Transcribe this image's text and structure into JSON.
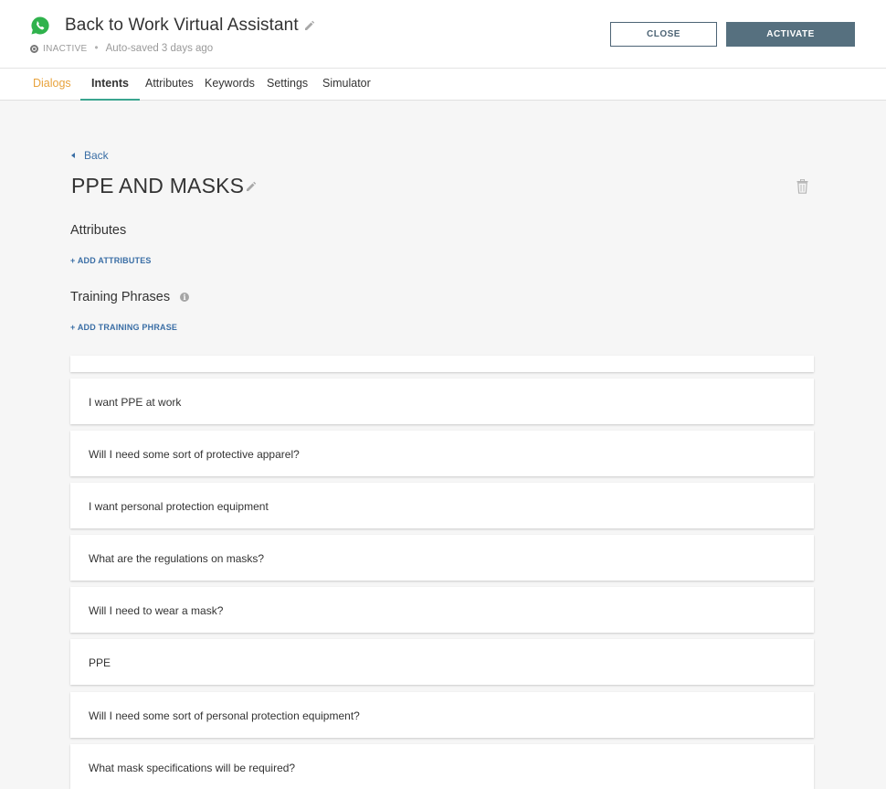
{
  "header": {
    "title": "Back to Work Virtual Assistant",
    "status": "INACTIVE",
    "autosave": "Auto-saved 3 days ago",
    "close_label": "CLOSE",
    "activate_label": "ACTIVATE"
  },
  "tabs": {
    "dialogs": "Dialogs",
    "intents": "Intents",
    "attributes": "Attributes",
    "keywords": "Keywords",
    "settings": "Settings",
    "simulator": "Simulator"
  },
  "intent": {
    "back_label": "Back",
    "name": "PPE AND MASKS",
    "attributes_heading": "Attributes",
    "add_attributes": "+ ADD ATTRIBUTES",
    "training_heading": "Training Phrases",
    "add_training_phrase": "+ ADD TRAINING PHRASE",
    "phrases": [
      "I want PPE at work",
      "Will I need some sort of protective apparel?",
      "I want personal protection equipment",
      "What are the regulations on masks?",
      "Will I need to wear a mask?",
      "PPE",
      "Will I need some sort of personal protection equipment?",
      "What mask specifications will be required?"
    ]
  },
  "colors": {
    "accent_orange": "#e8a33d",
    "tab_underline": "#3aa58f",
    "link_blue": "#3a6ea5",
    "activate_bg": "#56707f"
  },
  "icons": {
    "app": "whatsapp-icon",
    "edit": "pencil-icon",
    "delete": "trash-icon",
    "info": "info-icon",
    "back": "caret-left-icon"
  }
}
